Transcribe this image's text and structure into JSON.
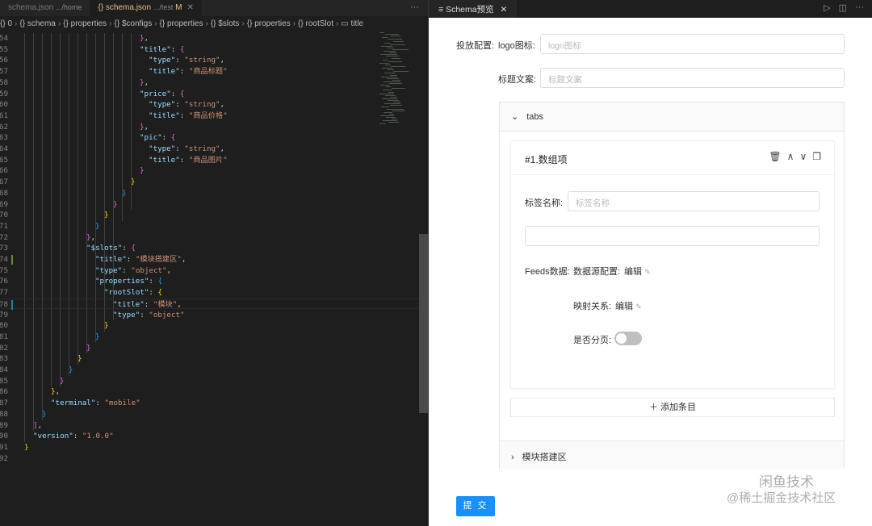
{
  "editor": {
    "tabs": [
      {
        "label": "schema.json",
        "path": ".../home",
        "active": false
      },
      {
        "label": "schema.json",
        "path": ".../test",
        "status": "M",
        "active": true
      }
    ],
    "breadcrumb": [
      "0",
      "schema",
      "properties",
      "$configs",
      "properties",
      "$slots",
      "properties",
      "rootSlot",
      "title"
    ],
    "more": "···",
    "lines": [
      {
        "n": 54,
        "i": 13,
        "t": [
          [
            "}",
            "b2"
          ],
          [
            ",",
            "p"
          ]
        ]
      },
      {
        "n": 55,
        "i": 13,
        "t": [
          [
            "\"title\"",
            "k"
          ],
          [
            ": ",
            "p"
          ],
          [
            "{",
            "b2"
          ]
        ]
      },
      {
        "n": 56,
        "i": 14,
        "t": [
          [
            "\"type\"",
            "k"
          ],
          [
            ": ",
            "p"
          ],
          [
            "\"string\"",
            "s"
          ],
          [
            ",",
            "p"
          ]
        ]
      },
      {
        "n": 57,
        "i": 14,
        "t": [
          [
            "\"title\"",
            "k"
          ],
          [
            ": ",
            "p"
          ],
          [
            "\"商品标题\"",
            "s"
          ]
        ]
      },
      {
        "n": 58,
        "i": 13,
        "t": [
          [
            "}",
            "b2"
          ],
          [
            ",",
            "p"
          ]
        ]
      },
      {
        "n": 59,
        "i": 13,
        "t": [
          [
            "\"price\"",
            "k"
          ],
          [
            ": ",
            "p"
          ],
          [
            "{",
            "b2"
          ]
        ]
      },
      {
        "n": 60,
        "i": 14,
        "t": [
          [
            "\"type\"",
            "k"
          ],
          [
            ": ",
            "p"
          ],
          [
            "\"string\"",
            "s"
          ],
          [
            ",",
            "p"
          ]
        ]
      },
      {
        "n": 61,
        "i": 14,
        "t": [
          [
            "\"title\"",
            "k"
          ],
          [
            ": ",
            "p"
          ],
          [
            "\"商品价格\"",
            "s"
          ]
        ]
      },
      {
        "n": 62,
        "i": 13,
        "t": [
          [
            "}",
            "b2"
          ],
          [
            ",",
            "p"
          ]
        ]
      },
      {
        "n": 63,
        "i": 13,
        "t": [
          [
            "\"pic\"",
            "k"
          ],
          [
            ": ",
            "p"
          ],
          [
            "{",
            "b2"
          ]
        ]
      },
      {
        "n": 64,
        "i": 14,
        "t": [
          [
            "\"type\"",
            "k"
          ],
          [
            ": ",
            "p"
          ],
          [
            "\"string\"",
            "s"
          ],
          [
            ",",
            "p"
          ]
        ]
      },
      {
        "n": 65,
        "i": 14,
        "t": [
          [
            "\"title\"",
            "k"
          ],
          [
            ": ",
            "p"
          ],
          [
            "\"商品图片\"",
            "s"
          ]
        ]
      },
      {
        "n": 66,
        "i": 13,
        "t": [
          [
            "}",
            "b2"
          ]
        ]
      },
      {
        "n": 67,
        "i": 12,
        "t": [
          [
            "}",
            "b1"
          ]
        ]
      },
      {
        "n": 68,
        "i": 11,
        "t": [
          [
            "}",
            "b3"
          ]
        ]
      },
      {
        "n": 69,
        "i": 10,
        "t": [
          [
            "}",
            "b2"
          ]
        ]
      },
      {
        "n": 70,
        "i": 9,
        "t": [
          [
            "}",
            "b1"
          ]
        ]
      },
      {
        "n": 71,
        "i": 8,
        "t": [
          [
            "}",
            "b3"
          ]
        ]
      },
      {
        "n": 72,
        "i": 7,
        "t": [
          [
            "}",
            "b2"
          ],
          [
            ",",
            "p"
          ]
        ]
      },
      {
        "n": 73,
        "i": 7,
        "t": [
          [
            "\"$slots\"",
            "k"
          ],
          [
            ": ",
            "p"
          ],
          [
            "{",
            "b2"
          ]
        ]
      },
      {
        "n": 74,
        "i": 8,
        "t": [
          [
            "\"title\"",
            "k"
          ],
          [
            ": ",
            "p"
          ],
          [
            "\"模块搭建区\"",
            "s"
          ],
          [
            ",",
            "p"
          ]
        ]
      },
      {
        "n": 75,
        "i": 8,
        "t": [
          [
            "\"type\"",
            "k"
          ],
          [
            ": ",
            "p"
          ],
          [
            "\"object\"",
            "s"
          ],
          [
            ",",
            "p"
          ]
        ]
      },
      {
        "n": 76,
        "i": 8,
        "t": [
          [
            "\"properties\"",
            "k"
          ],
          [
            ": ",
            "p"
          ],
          [
            "{",
            "b3"
          ]
        ]
      },
      {
        "n": 77,
        "i": 9,
        "t": [
          [
            "\"rootSlot\"",
            "k"
          ],
          [
            ": ",
            "p"
          ],
          [
            "{",
            "b1"
          ]
        ]
      },
      {
        "n": 78,
        "i": 10,
        "t": [
          [
            "\"title\"",
            "k"
          ],
          [
            ": ",
            "p"
          ],
          [
            "\"模块\"",
            "s"
          ],
          [
            ",",
            "p"
          ]
        ]
      },
      {
        "n": 79,
        "i": 10,
        "t": [
          [
            "\"type\"",
            "k"
          ],
          [
            ": ",
            "p"
          ],
          [
            "\"object\"",
            "s"
          ]
        ]
      },
      {
        "n": 80,
        "i": 9,
        "t": [
          [
            "}",
            "b1"
          ]
        ]
      },
      {
        "n": 81,
        "i": 8,
        "t": [
          [
            "}",
            "b3"
          ]
        ]
      },
      {
        "n": 82,
        "i": 7,
        "t": [
          [
            "}",
            "b2"
          ]
        ]
      },
      {
        "n": 83,
        "i": 6,
        "t": [
          [
            "}",
            "b1"
          ]
        ]
      },
      {
        "n": 84,
        "i": 5,
        "t": [
          [
            "}",
            "b3"
          ]
        ]
      },
      {
        "n": 85,
        "i": 4,
        "t": [
          [
            "}",
            "b2"
          ]
        ]
      },
      {
        "n": 86,
        "i": 3,
        "t": [
          [
            "}",
            "b1"
          ],
          [
            ",",
            "p"
          ]
        ]
      },
      {
        "n": 87,
        "i": 3,
        "t": [
          [
            "\"terminal\"",
            "k"
          ],
          [
            ": ",
            "p"
          ],
          [
            "\"mobile\"",
            "s"
          ]
        ]
      },
      {
        "n": 88,
        "i": 2,
        "t": [
          [
            "}",
            "b3"
          ]
        ]
      },
      {
        "n": 89,
        "i": 1,
        "t": [
          [
            "]",
            "b2"
          ],
          [
            ",",
            "p"
          ]
        ]
      },
      {
        "n": 90,
        "i": 1,
        "t": [
          [
            "\"version\"",
            "k"
          ],
          [
            ": ",
            "p"
          ],
          [
            "\"1.0.0\"",
            "s"
          ]
        ]
      },
      {
        "n": 91,
        "i": 0,
        "t": [
          [
            "}",
            "b1"
          ]
        ]
      },
      {
        "n": 92,
        "i": 0,
        "t": []
      }
    ]
  },
  "preview": {
    "tab_label": "Schema预览",
    "icons": [
      "run-icon",
      "split-editor-icon",
      "more-icon"
    ],
    "more": "···",
    "form": {
      "group_label": "投放配置:",
      "logo_label": "logo图标:",
      "logo_placeholder": "logo图标",
      "title_label": "标题文案:",
      "title_placeholder": "标题文案",
      "tabs_panel": {
        "title": "tabs",
        "item_title": "#1.数组项",
        "tag_label": "标签名称:",
        "tag_placeholder": "标签名称",
        "feeds_label": "Feeds数据:",
        "datasource_label": "数据源配置:",
        "datasource_edit": "编辑",
        "mapping_label": "映射关系:",
        "mapping_edit": "编辑",
        "paging_label": "是否分页:",
        "paging_on": false,
        "add_item": "添加条目"
      },
      "slots_panel_title": "模块搭建区",
      "submit": "提 交"
    },
    "watermark": {
      "line1": "闲鱼技术",
      "line2": "@稀土掘金技术社区"
    }
  }
}
